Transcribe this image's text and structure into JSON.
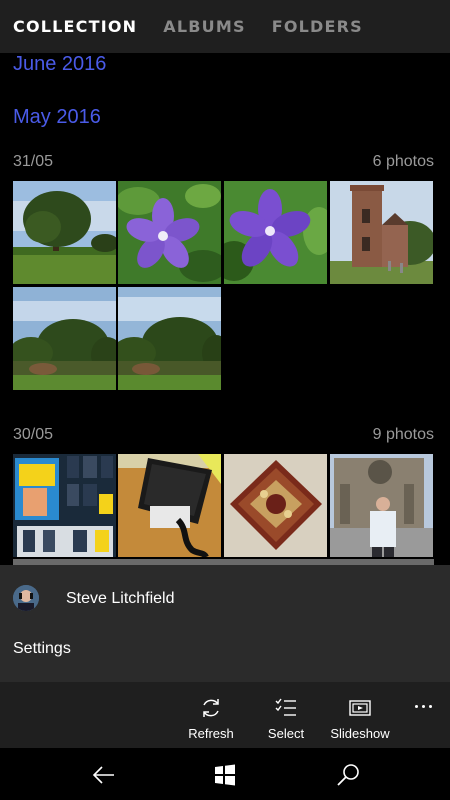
{
  "pivot": {
    "tabs": [
      {
        "label": "COLLECTION",
        "active": true
      },
      {
        "label": "ALBUMS",
        "active": false
      },
      {
        "label": "FOLDERS",
        "active": false
      }
    ]
  },
  "collection": {
    "months": [
      "June 2016",
      "May 2016"
    ],
    "groups": [
      {
        "date": "31/05",
        "count": "6 photos",
        "photos": [
          "tree-field-photo",
          "periwinkle-flower-photo",
          "periwinkle-flower-2-photo",
          "church-tower-photo",
          "garden-hedge-photo",
          "garden-hedge-2-photo"
        ]
      },
      {
        "date": "30/05",
        "count": "9 photos",
        "photos": [
          "phone-store-display-photo",
          "phone-on-desk-photo",
          "tiled-artwork-photo",
          "cathedral-man-photo"
        ]
      }
    ]
  },
  "account": {
    "name": "Steve Litchfield",
    "settings_label": "Settings"
  },
  "appbar": {
    "refresh_label": "Refresh",
    "select_label": "Select",
    "slideshow_label": "Slideshow",
    "more_icon": "more-icon"
  },
  "navbar": {
    "back_icon": "back-arrow-icon",
    "start_icon": "windows-start-icon",
    "search_icon": "search-icon"
  },
  "colors": {
    "accent": "#4a5be8",
    "header_bg": "#1f1f1f",
    "flyout_bg": "#2b2b2b",
    "muted_text": "#9a9a9a"
  }
}
